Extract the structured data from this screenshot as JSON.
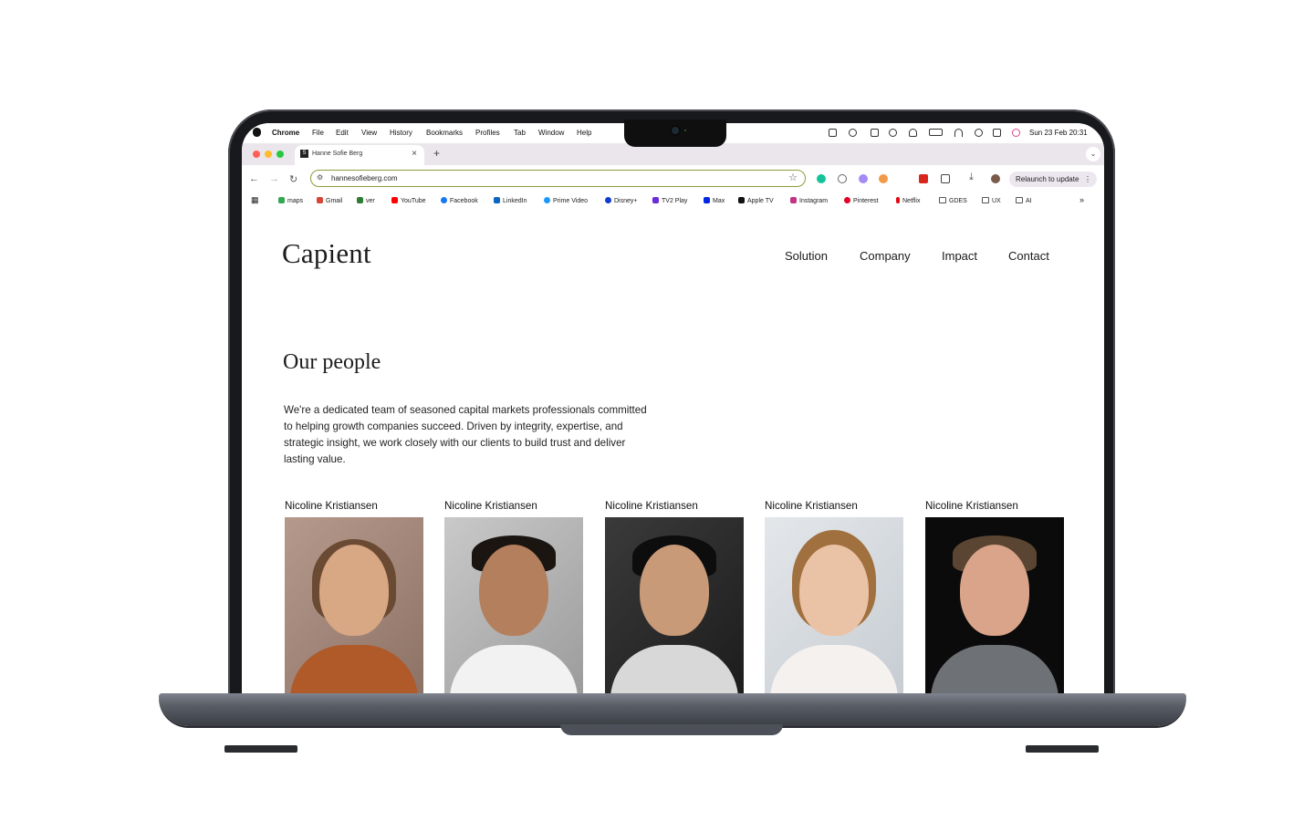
{
  "menubar": {
    "app": "Chrome",
    "items": [
      "File",
      "Edit",
      "View",
      "History",
      "Bookmarks",
      "Profiles",
      "Tab",
      "Window",
      "Help"
    ],
    "clock": "Sun 23 Feb  20:31"
  },
  "browser": {
    "tab_title": "Hanne Sofie Berg",
    "tab_close": "×",
    "new_tab": "+",
    "url": "hannesofieberg.com",
    "relaunch_label": "Relaunch to update",
    "bookmarks": [
      "maps",
      "Gmail",
      "ver",
      "YouTube",
      "Facebook",
      "LinkedIn",
      "Prime Video",
      "Disney+",
      "TV2 Play",
      "Max",
      "Apple TV",
      "Instagram",
      "Pinterest",
      "Netflix",
      "GDES",
      "UX",
      "AI"
    ],
    "bookmark_colors": [
      "#34a853",
      "#d44638",
      "#2e7d32",
      "#ff0000",
      "#1877f2",
      "#0a66c2",
      "#1a98ff",
      "#113ccf",
      "#6a2bd9",
      "#0026e6",
      "#111111",
      "#c13584",
      "#e60023",
      "#e50914",
      "#555555",
      "#555555",
      "#555555"
    ],
    "more": "»"
  },
  "site": {
    "logo": "Capient",
    "nav": [
      "Solution",
      "Company",
      "Impact",
      "Contact"
    ],
    "section_title": "Our people",
    "intro": "We're a dedicated team of seasoned capital markets professionals committed to helping growth companies succeed. Driven by integrity, expertise, and strategic insight, we work closely with our clients to build trust and deliver lasting value.",
    "people": [
      {
        "name": "Nicoline Kristiansen"
      },
      {
        "name": "Nicoline Kristiansen"
      },
      {
        "name": "Nicoline Kristiansen"
      },
      {
        "name": "Nicoline Kristiansen"
      },
      {
        "name": "Nicoline Kristiansen"
      }
    ]
  }
}
